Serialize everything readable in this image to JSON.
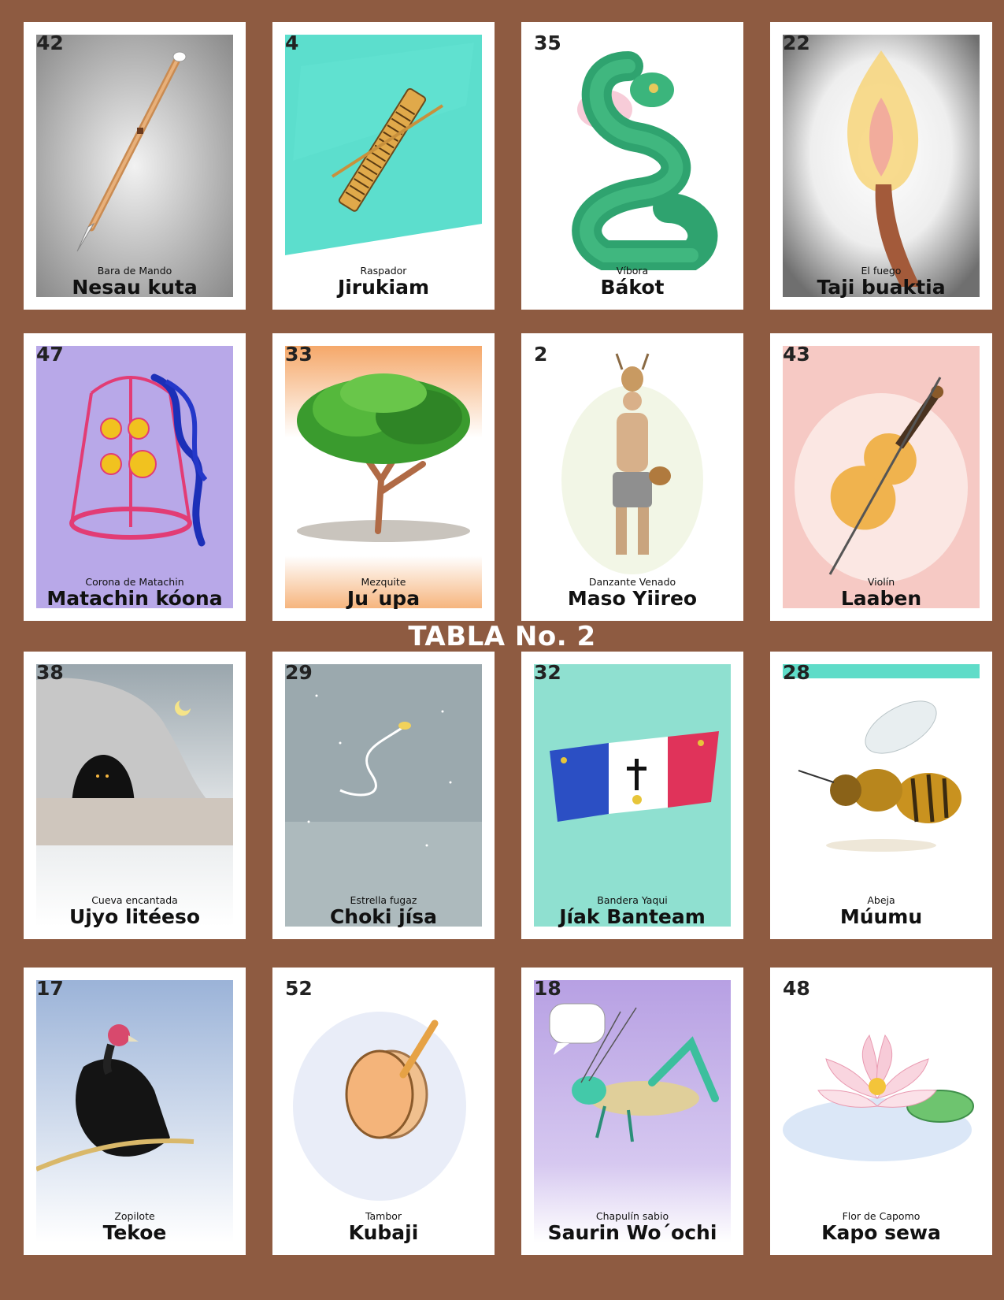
{
  "title": "TABLA No. 2",
  "cards": [
    {
      "number": "42",
      "spanish": "Bara de Mando",
      "yaqui": "Nesau kuta",
      "icon": "staff-icon"
    },
    {
      "number": "4",
      "spanish": "Raspador",
      "yaqui": "Jirukiam",
      "icon": "rasp-icon"
    },
    {
      "number": "35",
      "spanish": "Víbora",
      "yaqui": "Bákot",
      "icon": "snake-icon"
    },
    {
      "number": "22",
      "spanish": "El fuego",
      "yaqui": "Taji buaktia",
      "icon": "fire-icon"
    },
    {
      "number": "47",
      "spanish": "Corona de Matachin",
      "yaqui": "Matachin kóona",
      "icon": "crown-icon"
    },
    {
      "number": "33",
      "spanish": "Mezquite",
      "yaqui": "Ju´upa",
      "icon": "tree-icon"
    },
    {
      "number": "2",
      "spanish": "Danzante Venado",
      "yaqui": "Maso Yiireo",
      "icon": "deer-dancer-icon"
    },
    {
      "number": "43",
      "spanish": "Violín",
      "yaqui": "Laaben",
      "icon": "violin-icon"
    },
    {
      "number": "38",
      "spanish": "Cueva encantada",
      "yaqui": "Ujyo litéeso",
      "icon": "cave-icon"
    },
    {
      "number": "29",
      "spanish": "Estrella fugaz",
      "yaqui": "Choki jísa",
      "icon": "shooting-star-icon"
    },
    {
      "number": "32",
      "spanish": "Bandera Yaqui",
      "yaqui": "Jíak Banteam",
      "icon": "flag-icon"
    },
    {
      "number": "28",
      "spanish": "Abeja",
      "yaqui": "Múumu",
      "icon": "bee-icon"
    },
    {
      "number": "17",
      "spanish": "Zopilote",
      "yaqui": "Tekoe",
      "icon": "vulture-icon"
    },
    {
      "number": "52",
      "spanish": "Tambor",
      "yaqui": "Kubaji",
      "icon": "drum-icon"
    },
    {
      "number": "18",
      "spanish": "Chapulín sabio",
      "yaqui": "Saurin Wo´ochi",
      "icon": "grasshopper-icon"
    },
    {
      "number": "48",
      "spanish": "Flor de Capomo",
      "yaqui": "Kapo sewa",
      "icon": "flower-icon"
    }
  ]
}
